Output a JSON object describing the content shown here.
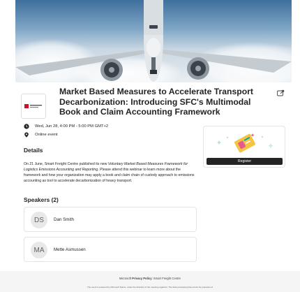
{
  "event": {
    "title": "Market Based Measures to Accelerate Transport Decarbonization: Introducing SFC's Multimodal Book and Claim Accounting Framework",
    "datetime": "Wed, Jun 28, 4:00 PM - 5:00 PM GMT+2",
    "location": "Online event"
  },
  "details": {
    "heading": "Details",
    "text_before": "On 21 June, Smart Freight Centre published its new ",
    "text_italic": "Voluntary Market Based Measures Framework for Logistics Emissions Accounting and Reporting",
    "text_after": ". Please attend this webinar to learn more about the framework and how your organization may apply a book and claim chain of custody approach to emissions accounting as tool to accelerate decarbonization of heavy transport."
  },
  "registration": {
    "button_label": "Register"
  },
  "speakers": {
    "heading": "Speakers (2)",
    "items": [
      {
        "initials": "DS",
        "name": "Dan Smith"
      },
      {
        "initials": "MA",
        "name": "Mette Asmussen"
      }
    ]
  },
  "footer": {
    "prefix": "Microsoft ",
    "privacy_link": "Privacy Policy",
    "org": ": Smart Freight Centre",
    "notice": "The event is powered by Microsoft Teams, under the direction of the meeting organizer. The data processing that occurs for purposes of"
  },
  "icons": {
    "calendar": "calendar-icon",
    "location": "location-pin-icon",
    "share": "share-icon",
    "ticket": "ticket-illustration"
  },
  "colors": {
    "button": "#242424",
    "accent_teal": "#00a5a8",
    "accent_pink": "#e65a8c",
    "ticket_yellow": "#f6c444"
  }
}
